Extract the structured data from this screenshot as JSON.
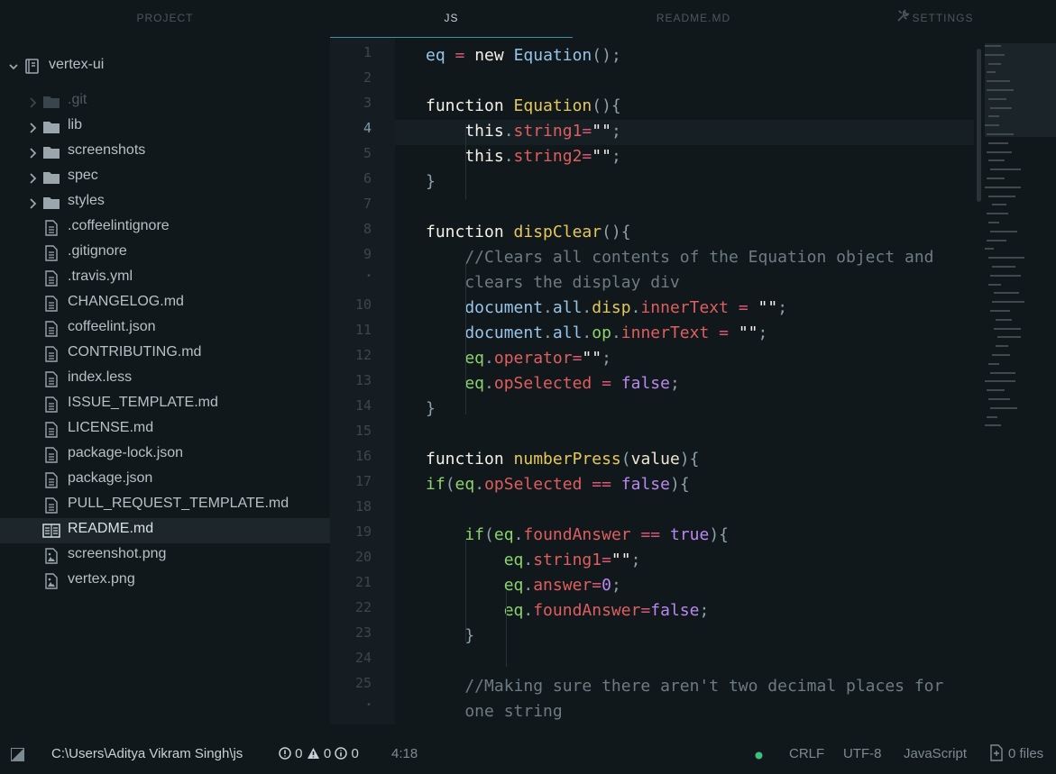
{
  "tabs": [
    {
      "label": "PROJECT",
      "active": false
    },
    {
      "label": "JS",
      "active": true
    },
    {
      "label": "README.MD",
      "active": false
    },
    {
      "label": "SETTINGS",
      "active": false,
      "icon": "wrench-screwdriver-icon"
    }
  ],
  "tree": {
    "root": {
      "label": "vertex-ui",
      "icon": "repo-icon",
      "expanded": true
    },
    "items": [
      {
        "label": ".git",
        "type": "folder",
        "dim": true
      },
      {
        "label": "lib",
        "type": "folder"
      },
      {
        "label": "screenshots",
        "type": "folder"
      },
      {
        "label": "spec",
        "type": "folder"
      },
      {
        "label": "styles",
        "type": "folder"
      },
      {
        "label": ".coffeelintignore",
        "type": "file"
      },
      {
        "label": ".gitignore",
        "type": "file"
      },
      {
        "label": ".travis.yml",
        "type": "file"
      },
      {
        "label": "CHANGELOG.md",
        "type": "file"
      },
      {
        "label": "coffeelint.json",
        "type": "file"
      },
      {
        "label": "CONTRIBUTING.md",
        "type": "file"
      },
      {
        "label": "index.less",
        "type": "file"
      },
      {
        "label": "ISSUE_TEMPLATE.md",
        "type": "file"
      },
      {
        "label": "LICENSE.md",
        "type": "file"
      },
      {
        "label": "package-lock.json",
        "type": "file"
      },
      {
        "label": "package.json",
        "type": "file"
      },
      {
        "label": "PULL_REQUEST_TEMPLATE.md",
        "type": "file"
      },
      {
        "label": "README.md",
        "type": "book",
        "selected": true
      },
      {
        "label": "screenshot.png",
        "type": "image"
      },
      {
        "label": "vertex.png",
        "type": "image"
      }
    ]
  },
  "editor": {
    "current_line": 4,
    "gutter": [
      "1",
      "2",
      "3",
      "4",
      "5",
      "6",
      "7",
      "8",
      "9",
      "•",
      "10",
      "11",
      "12",
      "13",
      "14",
      "15",
      "16",
      "17",
      "18",
      "19",
      "20",
      "21",
      "22",
      "23",
      "24",
      "25",
      "•"
    ],
    "lines": [
      [
        [
          "plain",
          "eq"
        ],
        [
          "op",
          " = "
        ],
        [
          "kw",
          "new "
        ],
        [
          "plain",
          "Equation"
        ],
        [
          "punc",
          "();"
        ]
      ],
      [],
      [
        [
          "kw",
          "function "
        ],
        [
          "fn",
          "Equation"
        ],
        [
          "punc",
          "(){"
        ]
      ],
      [
        [
          "kw",
          "    this"
        ],
        [
          "punc",
          "."
        ],
        [
          "prop",
          "string1"
        ],
        [
          "op",
          "="
        ],
        [
          "str",
          "\"\""
        ],
        [
          "punc",
          ";"
        ]
      ],
      [
        [
          "kw",
          "    this"
        ],
        [
          "punc",
          "."
        ],
        [
          "prop",
          "string2"
        ],
        [
          "op",
          "="
        ],
        [
          "str",
          "\"\""
        ],
        [
          "punc",
          ";"
        ]
      ],
      [
        [
          "punc",
          "}"
        ]
      ],
      [],
      [
        [
          "kw",
          "function "
        ],
        [
          "fn",
          "dispClear"
        ],
        [
          "punc",
          "(){"
        ]
      ],
      [
        [
          "cmt",
          "    //Clears all contents of the Equation object and"
        ]
      ],
      [
        [
          "cmt",
          "    clears the display div"
        ]
      ],
      [
        [
          "plain",
          "    document"
        ],
        [
          "punc",
          "."
        ],
        [
          "plain",
          "all"
        ],
        [
          "punc",
          "."
        ],
        [
          "fn",
          "disp"
        ],
        [
          "punc",
          "."
        ],
        [
          "prop",
          "innerText"
        ],
        [
          "op",
          " = "
        ],
        [
          "str",
          "\"\""
        ],
        [
          "punc",
          ";"
        ]
      ],
      [
        [
          "plain",
          "    document"
        ],
        [
          "punc",
          "."
        ],
        [
          "plain",
          "all"
        ],
        [
          "punc",
          "."
        ],
        [
          "green",
          "op"
        ],
        [
          "punc",
          "."
        ],
        [
          "prop",
          "innerText"
        ],
        [
          "op",
          " = "
        ],
        [
          "str",
          "\"\""
        ],
        [
          "punc",
          ";"
        ]
      ],
      [
        [
          "green",
          "    eq"
        ],
        [
          "punc",
          "."
        ],
        [
          "prop",
          "operator"
        ],
        [
          "op",
          "="
        ],
        [
          "str",
          "\"\""
        ],
        [
          "punc",
          ";"
        ]
      ],
      [
        [
          "green",
          "    eq"
        ],
        [
          "punc",
          "."
        ],
        [
          "prop",
          "opSelected"
        ],
        [
          "op",
          " = "
        ],
        [
          "bool",
          "false"
        ],
        [
          "punc",
          ";"
        ]
      ],
      [
        [
          "punc",
          "}"
        ]
      ],
      [],
      [
        [
          "kw",
          "function "
        ],
        [
          "fn",
          "numberPress"
        ],
        [
          "punc",
          "("
        ],
        [
          "ivory",
          "value"
        ],
        [
          "punc",
          "){"
        ]
      ],
      [
        [
          "green",
          "if"
        ],
        [
          "punc",
          "("
        ],
        [
          "green",
          "eq"
        ],
        [
          "punc",
          "."
        ],
        [
          "prop",
          "opSelected"
        ],
        [
          "op",
          " == "
        ],
        [
          "bool",
          "false"
        ],
        [
          "punc",
          "){"
        ]
      ],
      [],
      [
        [
          "green",
          "    if"
        ],
        [
          "punc",
          "("
        ],
        [
          "green",
          "eq"
        ],
        [
          "punc",
          "."
        ],
        [
          "prop",
          "foundAnswer"
        ],
        [
          "op",
          " == "
        ],
        [
          "bool",
          "true"
        ],
        [
          "punc",
          "){"
        ]
      ],
      [
        [
          "green",
          "        eq"
        ],
        [
          "punc",
          "."
        ],
        [
          "prop",
          "string1"
        ],
        [
          "op",
          "="
        ],
        [
          "str",
          "\"\""
        ],
        [
          "punc",
          ";"
        ]
      ],
      [
        [
          "green",
          "        eq"
        ],
        [
          "punc",
          "."
        ],
        [
          "prop",
          "answer"
        ],
        [
          "op",
          "="
        ],
        [
          "num",
          "0"
        ],
        [
          "punc",
          ";"
        ]
      ],
      [
        [
          "green",
          "        eq"
        ],
        [
          "punc",
          "."
        ],
        [
          "prop",
          "foundAnswer"
        ],
        [
          "op",
          "="
        ],
        [
          "bool",
          "false"
        ],
        [
          "punc",
          ";"
        ]
      ],
      [
        [
          "punc",
          "    }"
        ]
      ],
      [],
      [
        [
          "cmt",
          "    //Making sure there aren't two decimal places for"
        ]
      ],
      [
        [
          "cmt",
          "    one string"
        ]
      ]
    ]
  },
  "status": {
    "path": "C:\\Users\\Aditya Vikram Singh\\js",
    "errors": "0",
    "warnings": "0",
    "infos": "0",
    "cursor": "4:18",
    "line_ending": "CRLF",
    "encoding": "UTF-8",
    "grammar": "JavaScript",
    "files": "0 files",
    "git_dot_color": "#3fbf7f"
  }
}
